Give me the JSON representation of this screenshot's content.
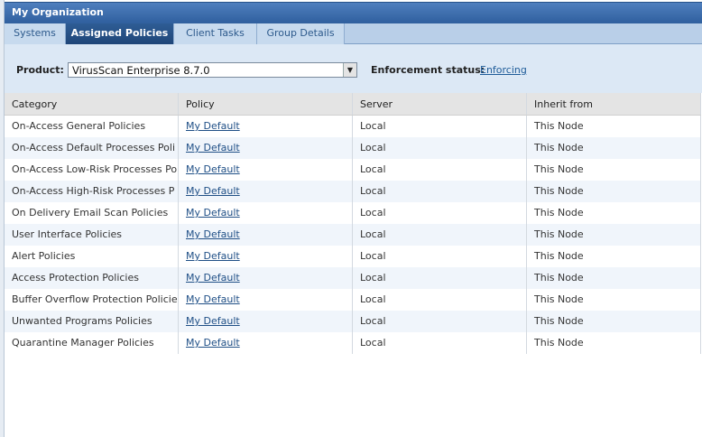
{
  "title": "My Organization",
  "tabs": [
    {
      "label": "Systems"
    },
    {
      "label": "Assigned Policies"
    },
    {
      "label": "Client Tasks"
    },
    {
      "label": "Group Details"
    }
  ],
  "toolbar": {
    "product_label": "Product:",
    "product_value": "VirusScan Enterprise 8.7.0",
    "enforcement_label": "Enforcement status:",
    "enforcement_value": "Enforcing"
  },
  "table": {
    "columns": [
      "Category",
      "Policy",
      "Server",
      "Inherit from"
    ],
    "rows": [
      {
        "category": "On-Access General Policies",
        "policy": "My Default",
        "server": "Local",
        "inherit": "This Node"
      },
      {
        "category": "On-Access Default Processes Poli",
        "policy": "My Default",
        "server": "Local",
        "inherit": "This Node"
      },
      {
        "category": "On-Access Low-Risk Processes Po",
        "policy": "My Default",
        "server": "Local",
        "inherit": "This Node"
      },
      {
        "category": "On-Access High-Risk Processes P",
        "policy": "My Default",
        "server": "Local",
        "inherit": "This Node"
      },
      {
        "category": "On Delivery Email Scan Policies",
        "policy": "My Default",
        "server": "Local",
        "inherit": "This Node"
      },
      {
        "category": "User Interface Policies",
        "policy": "My Default",
        "server": "Local",
        "inherit": "This Node"
      },
      {
        "category": "Alert Policies",
        "policy": "My Default",
        "server": "Local",
        "inherit": "This Node"
      },
      {
        "category": "Access Protection Policies",
        "policy": "My Default",
        "server": "Local",
        "inherit": "This Node"
      },
      {
        "category": "Buffer Overflow Protection Policie:",
        "policy": "My Default",
        "server": "Local",
        "inherit": "This Node"
      },
      {
        "category": "Unwanted Programs Policies",
        "policy": "My Default",
        "server": "Local",
        "inherit": "This Node"
      },
      {
        "category": "Quarantine Manager Policies",
        "policy": "My Default",
        "server": "Local",
        "inherit": "This Node"
      }
    ]
  },
  "colors": {
    "title_bar": "#2f5f9e",
    "active_tab": "#1f4678",
    "link": "#1f5c99",
    "alt_row": "#f0f5fb"
  }
}
